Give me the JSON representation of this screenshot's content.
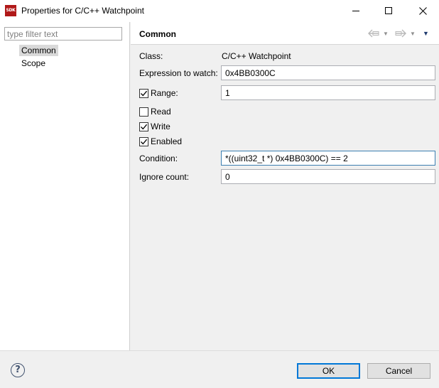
{
  "window": {
    "icon_text": "SDK",
    "title": "Properties for C/C++ Watchpoint"
  },
  "sidebar": {
    "filter_placeholder": "type filter text",
    "items": [
      {
        "label": "Common",
        "selected": true
      },
      {
        "label": "Scope",
        "selected": false
      }
    ]
  },
  "page": {
    "title": "Common",
    "class_label": "Class:",
    "class_value": "C/C++ Watchpoint",
    "expression_label": "Expression to watch:",
    "expression_value": "0x4BB0300C",
    "range_label": "Range:",
    "range_checked": true,
    "range_value": "1",
    "read_label": "Read",
    "read_checked": false,
    "write_label": "Write",
    "write_checked": true,
    "enabled_label": "Enabled",
    "enabled_checked": true,
    "condition_label": "Condition:",
    "condition_value": "*((uint32_t *) 0x4BB0300C) == 2",
    "ignore_label": "Ignore count:",
    "ignore_value": "0"
  },
  "icons": {
    "back": "back-arrow-icon",
    "forward": "forward-arrow-icon",
    "menu": "view-menu-icon",
    "help": "help-icon",
    "check": "checkmark-icon"
  },
  "buttons": {
    "ok_label": "OK",
    "cancel_label": "Cancel"
  },
  "colors": {
    "default_button_border": "#0078d7",
    "focused_field_border": "#3c7fb1",
    "selection": "#d9d9d9"
  }
}
